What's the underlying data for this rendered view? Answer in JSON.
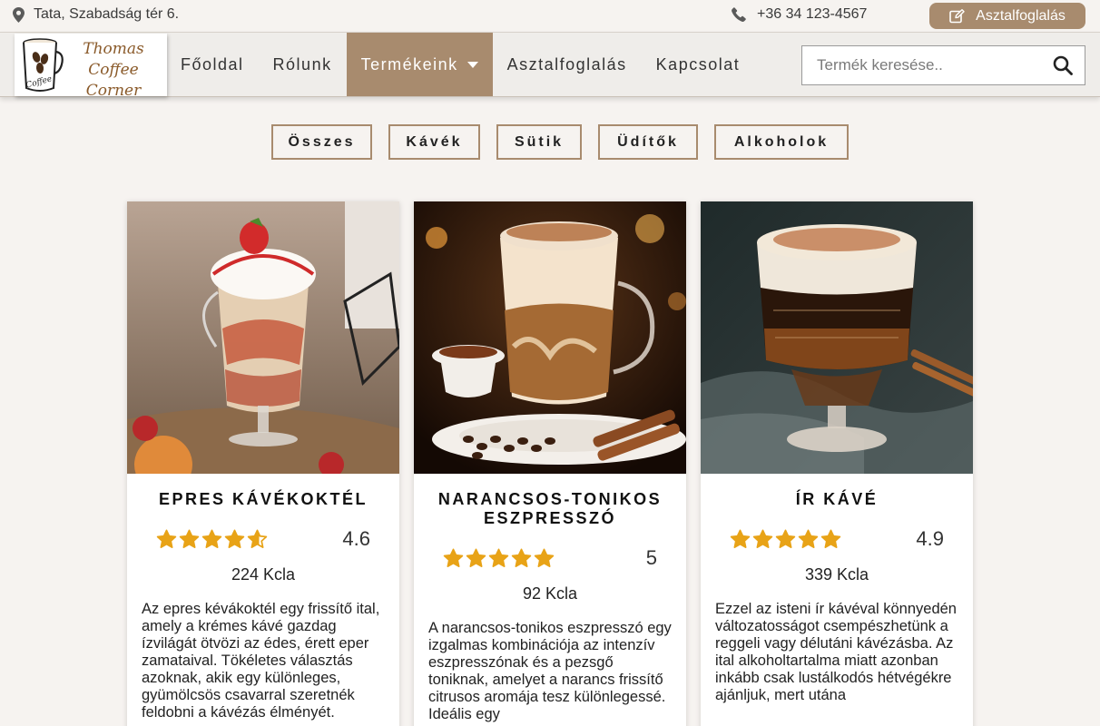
{
  "topbar": {
    "address": "Tata, Szabadság tér 6.",
    "phone": "+36 34 123-4567",
    "reserve_label": "Asztalfoglalás"
  },
  "logo": {
    "line1": "Thomas Coffee",
    "line2": "Corner",
    "cup_text": "Coffee"
  },
  "nav": {
    "items": [
      {
        "label": "Főoldal"
      },
      {
        "label": "Rólunk"
      },
      {
        "label": "Termékeink"
      },
      {
        "label": "Asztalfoglalás"
      },
      {
        "label": "Kapcsolat"
      }
    ],
    "active_index": 2
  },
  "search": {
    "placeholder": "Termék keresése.."
  },
  "filters": [
    {
      "label": "Összes"
    },
    {
      "label": "Kávék"
    },
    {
      "label": "Sütik"
    },
    {
      "label": "Üdítők"
    },
    {
      "label": "Alkoholok"
    }
  ],
  "colors": {
    "accent": "#a88b6e",
    "star": "#e8a317",
    "background": "#f6f3f0"
  },
  "products": [
    {
      "title": "EPRES KÁVÉKOKTÉL",
      "rating": 4.6,
      "rating_text": "4.6",
      "kcal": "224 Kcla",
      "description": "Az epres kévákoktél egy frissítő ital, amely a krémes kávé gazdag ízvilágát ötvözi az édes, érett eper zamataival. Tökéletes választás azoknak, akik egy különleges, gyümölcsös csavarral szeretnék feldobni a kávézás élményét."
    },
    {
      "title": "NARANCSOS-TONIKOS ESZPRESSZÓ",
      "rating": 5,
      "rating_text": "5",
      "kcal": "92 Kcla",
      "description": "A narancsos-tonikos eszpresszó egy izgalmas kombinációja az intenzív eszpresszónak és a pezsgő toniknak, amelyet a narancs frissítő citrusos aromája tesz különlegessé. Ideális egy"
    },
    {
      "title": "ÍR KÁVÉ",
      "rating": 4.9,
      "rating_text": "4.9",
      "kcal": "339 Kcla",
      "description": "Ezzel az isteni ír kávéval könnyedén változatosságot csempészhetünk a reggeli vagy délutáni kávézásba. Az ital alkoholtartalma miatt azonban inkább csak lustálkodós hétvégékre ajánljuk, mert utána"
    }
  ]
}
